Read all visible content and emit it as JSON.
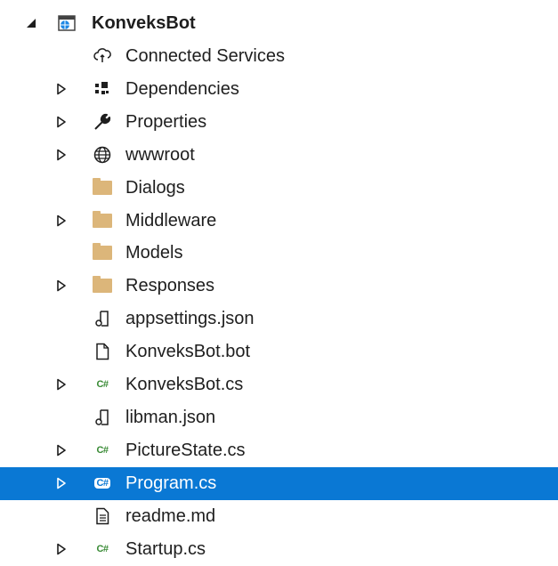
{
  "project": {
    "name": "KonveksBot",
    "expanded": true,
    "icon": "web-project-icon"
  },
  "items": [
    {
      "label": "Connected Services",
      "icon": "connected-services-icon",
      "expander": "none"
    },
    {
      "label": "Dependencies",
      "icon": "dependencies-icon",
      "expander": "collapsed"
    },
    {
      "label": "Properties",
      "icon": "wrench-icon",
      "expander": "collapsed"
    },
    {
      "label": "wwwroot",
      "icon": "globe-icon",
      "expander": "collapsed"
    },
    {
      "label": "Dialogs",
      "icon": "folder-icon",
      "expander": "none"
    },
    {
      "label": "Middleware",
      "icon": "folder-icon",
      "expander": "collapsed"
    },
    {
      "label": "Models",
      "icon": "folder-icon",
      "expander": "none"
    },
    {
      "label": "Responses",
      "icon": "folder-icon",
      "expander": "collapsed"
    },
    {
      "label": "appsettings.json",
      "icon": "json-file-icon",
      "expander": "none"
    },
    {
      "label": "KonveksBot.bot",
      "icon": "file-icon",
      "expander": "none"
    },
    {
      "label": "KonveksBot.cs",
      "icon": "csharp-file-icon",
      "expander": "collapsed"
    },
    {
      "label": "libman.json",
      "icon": "json-file-icon",
      "expander": "none"
    },
    {
      "label": "PictureState.cs",
      "icon": "csharp-file-icon",
      "expander": "collapsed"
    },
    {
      "label": "Program.cs",
      "icon": "csharp-file-icon",
      "expander": "collapsed",
      "selected": true
    },
    {
      "label": "readme.md",
      "icon": "text-file-icon",
      "expander": "none"
    },
    {
      "label": "Startup.cs",
      "icon": "csharp-file-icon",
      "expander": "collapsed"
    }
  ],
  "colors": {
    "selection": "#0a78d4",
    "folder": "#dcb67a",
    "csharp": "#388a34"
  },
  "csharp_glyph": "C#"
}
